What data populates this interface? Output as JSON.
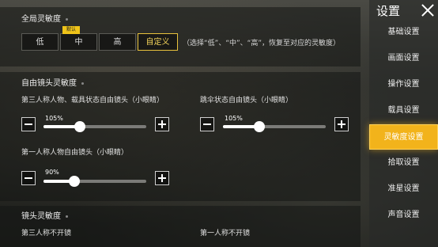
{
  "sidebar": {
    "title": "设置",
    "items": [
      {
        "label": "基础设置"
      },
      {
        "label": "画面设置"
      },
      {
        "label": "操作设置"
      },
      {
        "label": "载具设置"
      },
      {
        "label": "灵敏度设置",
        "active": true
      },
      {
        "label": "拾取设置"
      },
      {
        "label": "准星设置"
      },
      {
        "label": "声音设置"
      }
    ]
  },
  "global": {
    "title": "全局灵敏度",
    "badge": "默认",
    "options": [
      "低",
      "中",
      "高",
      "自定义"
    ],
    "selected": "自定义",
    "note": "（选择“低”、“中”、“高”，恢复至对应的灵敏度）"
  },
  "free_camera": {
    "title": "自由镜头灵敏度",
    "third_person": {
      "label": "第三人称人物、载具状态自由镜头（小眼睛）",
      "value": "105%",
      "level": 0.35
    },
    "parachute": {
      "label": "跳伞状态自由镜头（小眼睛）",
      "value": "105%",
      "level": 0.35
    },
    "first_person": {
      "label": "第一人称人物自由镜头（小眼睛）",
      "value": "90%",
      "level": 0.3
    }
  },
  "lens": {
    "title": "镜头灵敏度",
    "third_no_scope": "第三人称不开镜",
    "first_no_scope": "第一人称不开镜"
  },
  "colors": {
    "accent": "#f2b31b",
    "selected_text": "#f3d35a"
  }
}
